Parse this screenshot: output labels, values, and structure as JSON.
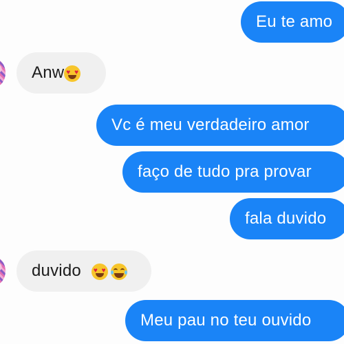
{
  "messages": [
    {
      "direction": "out",
      "text": "Eu te amo"
    },
    {
      "direction": "in",
      "text": "Anw",
      "emoji": [
        "smiling-face-with-heart-eyes"
      ]
    },
    {
      "direction": "out",
      "text": "Vc é meu verdadeiro amor"
    },
    {
      "direction": "out",
      "text": "faço de tudo pra provar"
    },
    {
      "direction": "out",
      "text": "fala duvido"
    },
    {
      "direction": "in",
      "text": "duvido",
      "emoji": [
        "smiling-face-with-heart-eyes",
        "face-with-tears-of-joy"
      ]
    },
    {
      "direction": "out",
      "text": "Meu pau no teu ouvido"
    }
  ],
  "colors": {
    "outgoing_bubble": "#1a84f7",
    "incoming_bubble": "#f0f0f0",
    "outgoing_text": "#ffffff",
    "incoming_text": "#1c1c1c"
  }
}
